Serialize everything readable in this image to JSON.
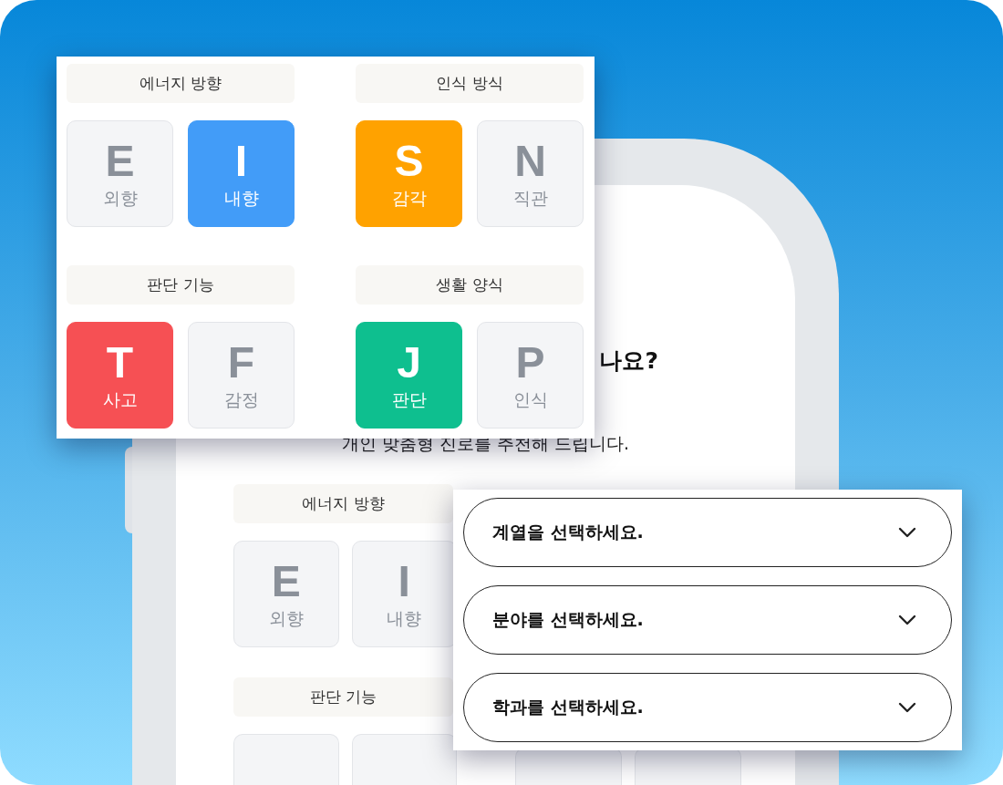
{
  "phone": {
    "heading": "나요?",
    "subtitle": "개인 맞춤형 진로를 추천해 드립니다.",
    "sections": [
      {
        "title": "에너지 방향",
        "options": [
          {
            "letter": "E",
            "label": "외향",
            "selected": false
          },
          {
            "letter": "I",
            "label": "내향",
            "selected": false
          }
        ]
      },
      {
        "title": "판단 기능"
      }
    ]
  },
  "mbti_panel": {
    "groups": [
      {
        "title": "에너지 방향",
        "options": [
          {
            "letter": "E",
            "label": "외향",
            "selected": false
          },
          {
            "letter": "I",
            "label": "내향",
            "selected": true,
            "color": "#429cf8"
          }
        ]
      },
      {
        "title": "인식 방식",
        "options": [
          {
            "letter": "S",
            "label": "감각",
            "selected": true,
            "color": "#ffa200"
          },
          {
            "letter": "N",
            "label": "직관",
            "selected": false
          }
        ]
      },
      {
        "title": "판단 기능",
        "options": [
          {
            "letter": "T",
            "label": "사고",
            "selected": true,
            "color": "#f65054"
          },
          {
            "letter": "F",
            "label": "감정",
            "selected": false
          }
        ]
      },
      {
        "title": "생활 양식",
        "options": [
          {
            "letter": "J",
            "label": "판단",
            "selected": true,
            "color": "#0ebf8f"
          },
          {
            "letter": "P",
            "label": "인식",
            "selected": false
          }
        ]
      }
    ]
  },
  "select_panel": {
    "selects": [
      {
        "placeholder": "계열을 선택하세요."
      },
      {
        "placeholder": "분야를 선택하세요."
      },
      {
        "placeholder": "학과를 선택하세요."
      }
    ]
  }
}
